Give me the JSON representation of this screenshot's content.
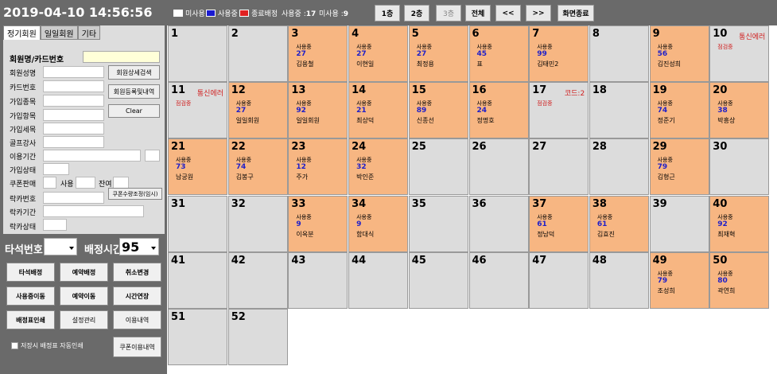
{
  "clock": "2019-04-10 14:56:56",
  "legend": [
    {
      "label": "미사용",
      "color": "#ffffff"
    },
    {
      "label": "사용중",
      "color": "#1a1ad0"
    },
    {
      "label": "종료배정",
      "color": "#e02020"
    }
  ],
  "stats": {
    "inuse_label": "사용중 :",
    "inuse": "17",
    "free_label": "미사용 :",
    "free": "9"
  },
  "floor_buttons": [
    "1층",
    "2층",
    "3층",
    "전체",
    "<<",
    ">>",
    "화면종료"
  ],
  "tabs": [
    "정기회원",
    "일일회원",
    "기타"
  ],
  "form": {
    "member_card_label": "회원명/카드번호",
    "labels": [
      "회원성명",
      "카드번호",
      "가입종목",
      "가입항목",
      "가입세목",
      "골프강사",
      "이용기간",
      "가입상태",
      "쿠폰판매",
      "락카번호",
      "락카기간",
      "락카상태"
    ],
    "use_label": "사용",
    "remain_label": "잔여",
    "btn_detail": "회원상세검색",
    "btn_history": "회원등록및내역",
    "btn_clear": "Clear",
    "btn_coupon_adjust": "쿠폰수량조정(임시)"
  },
  "bottom": {
    "seat_label": "타석번호",
    "time_label": "배정시간",
    "time_value": "95",
    "buttons": [
      "타석배정",
      "예약배정",
      "취소변경",
      "사용중이동",
      "예약이동",
      "시간연장",
      "배정표인쇄",
      "설정관리",
      "이용내역"
    ],
    "autoprint_label": "저장시 배정표 자동인쇄",
    "coupon_history": "쿠폰이용내역"
  },
  "cells": [
    {
      "n": "1"
    },
    {
      "n": "2"
    },
    {
      "n": "3",
      "on": true,
      "s": "사용중",
      "t": "27",
      "m": "김용철"
    },
    {
      "n": "4",
      "on": true,
      "s": "사용중",
      "t": "27",
      "m": "이현일"
    },
    {
      "n": "5",
      "on": true,
      "s": "사용중",
      "t": "27",
      "m": "최정용"
    },
    {
      "n": "6",
      "on": true,
      "s": "사용중",
      "t": "45",
      "m": "표"
    },
    {
      "n": "7",
      "on": true,
      "s": "사용중",
      "t": "99",
      "m": "김태민2"
    },
    {
      "n": "8"
    },
    {
      "n": "9",
      "on": true,
      "s": "사용중",
      "t": "56",
      "m": "김진성희"
    },
    {
      "n": "10",
      "note": "통신에러",
      "sub": "점검중"
    },
    {
      "n": "11",
      "note": "통신에러",
      "sub": "점검중"
    },
    {
      "n": "12",
      "on": true,
      "s": "사용중",
      "t": "27",
      "m": "일일회원"
    },
    {
      "n": "13",
      "on": true,
      "s": "사용중",
      "t": "92",
      "m": "일일회원"
    },
    {
      "n": "14",
      "on": true,
      "s": "사용중",
      "t": "21",
      "m": "최상덕"
    },
    {
      "n": "15",
      "on": true,
      "s": "사용중",
      "t": "89",
      "m": "신종선"
    },
    {
      "n": "16",
      "on": true,
      "s": "사용중",
      "t": "24",
      "m": "정명호"
    },
    {
      "n": "17",
      "note": "코드:2",
      "sub": "점검중"
    },
    {
      "n": "18"
    },
    {
      "n": "19",
      "on": true,
      "s": "사용중",
      "t": "74",
      "m": "정준기"
    },
    {
      "n": "20",
      "on": true,
      "s": "사용중",
      "t": "38",
      "m": "박흥상"
    },
    {
      "n": "21",
      "on": true,
      "s": "사용중",
      "t": "73",
      "m": "남궁원"
    },
    {
      "n": "22",
      "on": true,
      "s": "사용중",
      "t": "74",
      "m": "김봉구"
    },
    {
      "n": "23",
      "on": true,
      "s": "사용중",
      "t": "12",
      "m": "주가"
    },
    {
      "n": "24",
      "on": true,
      "s": "사용중",
      "t": "32",
      "m": "박인준"
    },
    {
      "n": "25"
    },
    {
      "n": "26"
    },
    {
      "n": "27"
    },
    {
      "n": "28"
    },
    {
      "n": "29",
      "on": true,
      "s": "사용중",
      "t": "79",
      "m": "김형근"
    },
    {
      "n": "30"
    },
    {
      "n": "31"
    },
    {
      "n": "32"
    },
    {
      "n": "33",
      "on": true,
      "s": "사용중",
      "t": "9",
      "m": "이옥분"
    },
    {
      "n": "34",
      "on": true,
      "s": "사용중",
      "t": "9",
      "m": "함대식"
    },
    {
      "n": "35"
    },
    {
      "n": "36"
    },
    {
      "n": "37",
      "on": true,
      "s": "사용중",
      "t": "61",
      "m": "정남덕"
    },
    {
      "n": "38",
      "on": true,
      "s": "사용중",
      "t": "61",
      "m": "김효진"
    },
    {
      "n": "39"
    },
    {
      "n": "40",
      "on": true,
      "s": "사용중",
      "t": "92",
      "m": "최재혁"
    },
    {
      "n": "41"
    },
    {
      "n": "42"
    },
    {
      "n": "43"
    },
    {
      "n": "44"
    },
    {
      "n": "45"
    },
    {
      "n": "46"
    },
    {
      "n": "47"
    },
    {
      "n": "48"
    },
    {
      "n": "49",
      "on": true,
      "s": "사용중",
      "t": "79",
      "m": "조성희"
    },
    {
      "n": "50",
      "on": true,
      "s": "사용중",
      "t": "80",
      "m": "곽연희"
    },
    {
      "n": "51"
    },
    {
      "n": "52"
    }
  ]
}
